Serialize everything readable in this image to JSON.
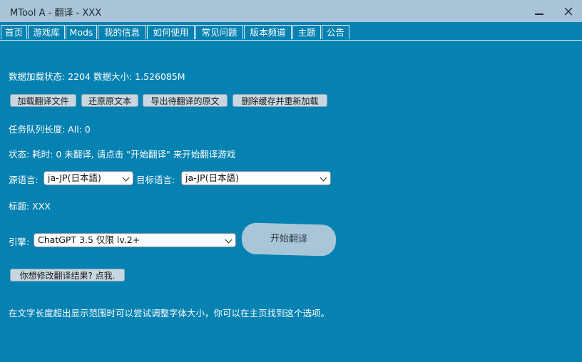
{
  "window": {
    "title": "MTool A - 翻译 - XXX"
  },
  "tabs": [
    "首页",
    "游戏库",
    "Mods",
    "我的信息",
    "如何使用",
    "常见问题",
    "版本频道",
    "主题",
    "公告"
  ],
  "status_line": "数据加载状态: 2204 数据大小: 1.526085M",
  "actions": {
    "load": "加载翻译文件",
    "restore": "还原原文本",
    "export": "导出待翻译的原文",
    "clear_reload": "删除缓存并重新加载"
  },
  "queue_line": "任务队列长度: All: 0",
  "progress_line": "状态: 耗时: 0 未翻译, 请点击 \"开始翻译\" 来开始翻译游戏",
  "source_lang": {
    "label": "源语言:",
    "value": "ja-JP(日本語)"
  },
  "target_lang": {
    "label": "目标语言:",
    "value": "ja-JP(日本語)"
  },
  "title_line": "标题: XXX",
  "engine": {
    "label": "引擎:",
    "value": "ChatGPT 3.5 仅限 lv.2+"
  },
  "start_button": "开始翻译",
  "modify_button": "你想修改翻译结果? 点我.",
  "hint": "在文字长度超出显示范围时可以尝试调整字体大小，你可以在主页找到这个选项。"
}
